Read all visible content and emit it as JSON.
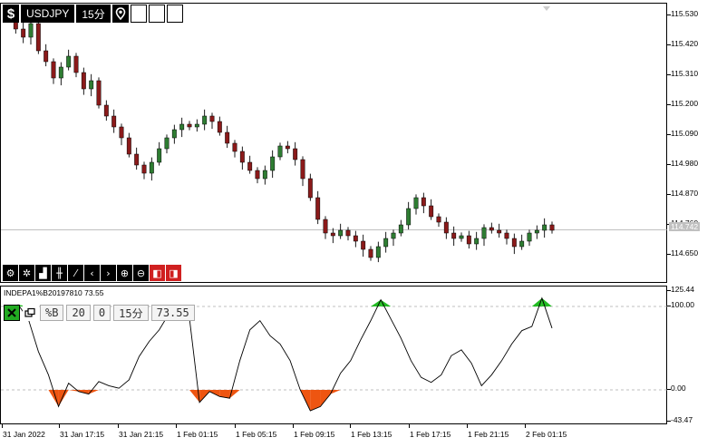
{
  "toolbar": {
    "dollar_icon": "$",
    "symbol": "USDJPY",
    "timeframe": "15分",
    "pin_icon": "location-pin"
  },
  "main_axis": {
    "labels": [
      "115.530",
      "115.420",
      "115.310",
      "115.200",
      "115.090",
      "114.980",
      "114.870",
      "114.760",
      "114.650"
    ],
    "current_price": "114.742"
  },
  "tools": [
    "gear-pair",
    "gear",
    "bar-chart",
    "bars-small",
    "trend-lines",
    "arrow-left",
    "arrow-right",
    "zoom-in",
    "zoom-out",
    "split-left",
    "split-right"
  ],
  "indicator": {
    "title": "INDEPA1%B20197810 73.55",
    "window_icon": "restore-window",
    "name": "%B",
    "period": "20",
    "shift": "0",
    "timeframe": "15分",
    "value": "73.55",
    "axis_labels": [
      "125.44",
      "100.00",
      "0.00",
      "-43.47"
    ]
  },
  "time_axis": [
    "31 Jan 2022",
    "31 Jan 17:15",
    "31 Jan 21:15",
    "1 Feb 01:15",
    "1 Feb 05:15",
    "1 Feb 09:15",
    "1 Feb 13:15",
    "1 Feb 17:15",
    "1 Feb 21:15",
    "2 Feb 01:15"
  ],
  "colors": {
    "bull": "#2e7d32",
    "bear": "#8b1a1a",
    "overbought": "#22bb22",
    "oversold": "#ee5511",
    "level_line": "#aaaaaa"
  },
  "chart_data": {
    "type": "line",
    "instrument": "USDJPY",
    "timeframe": "15分",
    "price_range": [
      114.6,
      115.55
    ],
    "price_close": [
      115.52,
      115.48,
      115.45,
      115.5,
      115.4,
      115.36,
      115.3,
      115.34,
      115.38,
      115.32,
      115.26,
      115.29,
      115.2,
      115.16,
      115.12,
      115.08,
      115.02,
      114.98,
      114.95,
      114.99,
      115.04,
      115.08,
      115.11,
      115.13,
      115.12,
      115.13,
      115.16,
      115.14,
      115.1,
      115.06,
      115.03,
      114.99,
      114.96,
      114.93,
      114.96,
      115.01,
      115.05,
      115.04,
      115.0,
      114.93,
      114.86,
      114.78,
      114.73,
      114.72,
      114.74,
      114.72,
      114.7,
      114.67,
      114.64,
      114.68,
      114.71,
      114.73,
      114.76,
      114.82,
      114.86,
      114.83,
      114.79,
      114.77,
      114.73,
      114.71,
      114.72,
      114.69,
      114.71,
      114.75,
      114.74,
      114.73,
      114.71,
      114.68,
      114.7,
      114.73,
      114.74,
      114.76,
      114.74
    ],
    "percent_b": [
      98,
      102,
      85,
      46,
      18,
      -20,
      8,
      -2,
      -5,
      10,
      5,
      2,
      12,
      40,
      58,
      72,
      92,
      95,
      86,
      -15,
      -2,
      -8,
      -10,
      35,
      72,
      83,
      65,
      55,
      35,
      0,
      -25,
      -20,
      -5,
      20,
      35,
      60,
      83,
      108,
      85,
      62,
      35,
      15,
      9,
      18,
      41,
      48,
      32,
      5,
      18,
      35,
      55,
      71,
      76,
      110,
      74
    ]
  }
}
